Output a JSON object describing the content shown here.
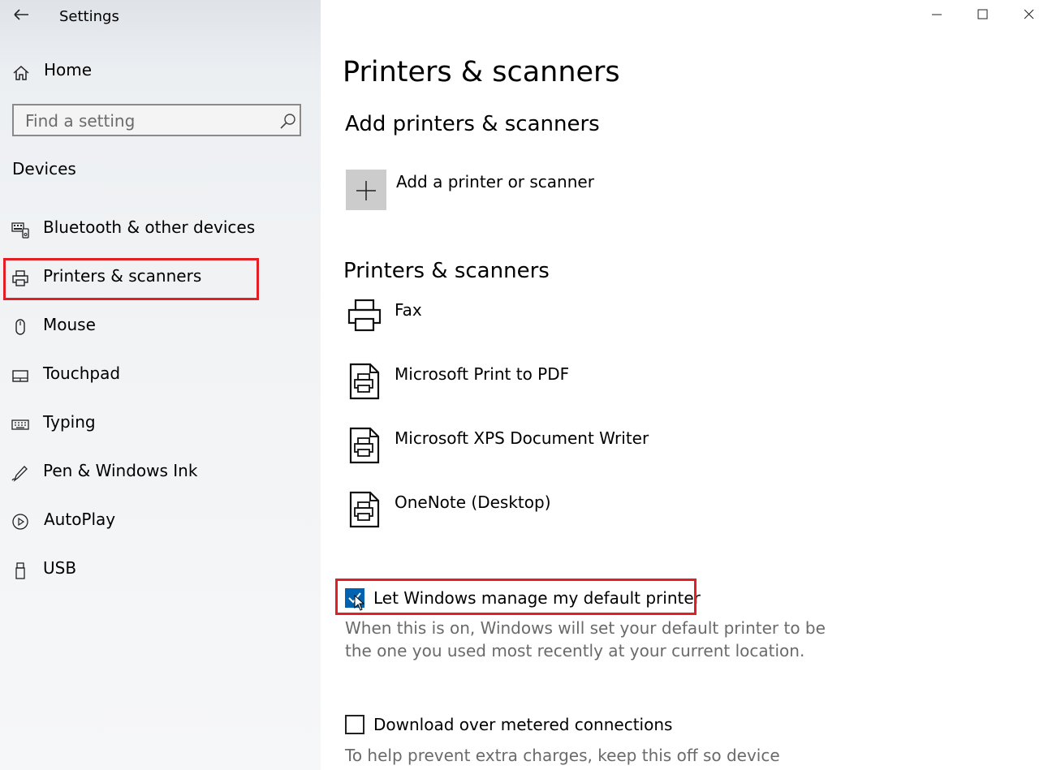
{
  "window": {
    "title": "Settings",
    "back_icon": "back-arrow-icon",
    "controls": [
      "minimize-icon",
      "maximize-icon",
      "close-icon"
    ]
  },
  "sidebar": {
    "home_label": "Home",
    "search_placeholder": "Find a setting",
    "section_title": "Devices",
    "items": [
      {
        "label": "Bluetooth & other devices",
        "icon": "bluetooth-devices-icon"
      },
      {
        "label": "Printers & scanners",
        "icon": "printer-icon",
        "selected": true
      },
      {
        "label": "Mouse",
        "icon": "mouse-icon"
      },
      {
        "label": "Touchpad",
        "icon": "touchpad-icon"
      },
      {
        "label": "Typing",
        "icon": "keyboard-icon"
      },
      {
        "label": "Pen & Windows Ink",
        "icon": "pen-icon"
      },
      {
        "label": "AutoPlay",
        "icon": "autoplay-icon"
      },
      {
        "label": "USB",
        "icon": "usb-icon"
      }
    ]
  },
  "main": {
    "page_title": "Printers & scanners",
    "add_section_title": "Add printers & scanners",
    "add_button_label": "Add a printer or scanner",
    "list_section_title": "Printers & scanners",
    "printers": [
      {
        "name": "Fax",
        "icon": "printer-icon"
      },
      {
        "name": "Microsoft Print to PDF",
        "icon": "document-printer-icon"
      },
      {
        "name": "Microsoft XPS Document Writer",
        "icon": "document-printer-icon"
      },
      {
        "name": "OneNote (Desktop)",
        "icon": "document-printer-icon"
      }
    ],
    "default_printer": {
      "label": "Let Windows manage my default printer",
      "checked": true,
      "description_line1": "When this is on, Windows will set your default printer to be",
      "description_line2": "the one you used most recently at your current location."
    },
    "metered": {
      "label": "Download over metered connections",
      "checked": false,
      "description_line1": "To help prevent extra charges, keep this off so device"
    }
  },
  "colors": {
    "highlight_box": "#e31e24",
    "checkbox_checked": "#0063b1",
    "description_text": "#6a6a6a"
  }
}
